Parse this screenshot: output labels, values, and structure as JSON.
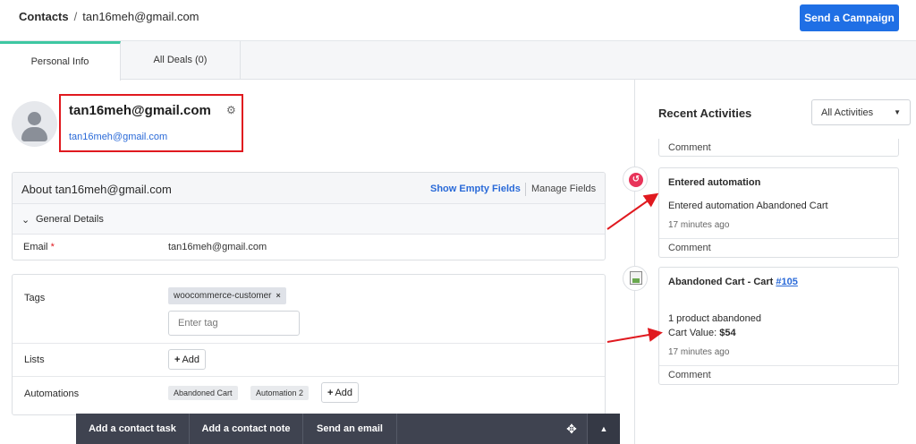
{
  "header": {
    "breadcrumb_root": "Contacts",
    "breadcrumb_sep": "/",
    "breadcrumb_current": "tan16meh@gmail.com",
    "send_campaign": "Send a Campaign"
  },
  "tabs": [
    {
      "label": "Personal Info",
      "active": true
    },
    {
      "label": "All Deals (0)",
      "active": false
    }
  ],
  "contact": {
    "name": "tan16meh@gmail.com",
    "email": "tan16meh@gmail.com"
  },
  "about": {
    "title": "About tan16meh@gmail.com",
    "show_empty": "Show Empty Fields",
    "manage": "Manage Fields",
    "section": "General Details",
    "email_label": "Email",
    "required_mark": "*",
    "email_value": "tan16meh@gmail.com"
  },
  "tags_panel": {
    "tags_label": "Tags",
    "tag": "woocommerce-customer",
    "tag_remove": "×",
    "tag_placeholder": "Enter tag",
    "lists_label": "Lists",
    "add_label": "Add",
    "automations_label": "Automations",
    "automations": [
      "Abandoned Cart",
      "Automation 2"
    ]
  },
  "actionbar": {
    "task": "Add a contact task",
    "note": "Add a contact note",
    "email": "Send an email"
  },
  "activities": {
    "title": "Recent Activities",
    "filter": "All Activities",
    "stub_comment": "Comment",
    "card1": {
      "title": "Entered automation",
      "text_prefix": "Entered automation ",
      "text_value": "Abandoned Cart",
      "time": "17 minutes ago",
      "comment": "Comment"
    },
    "card2": {
      "title": "Abandoned Cart - Cart ",
      "link": "#105",
      "count": "1",
      "count_text": " product abandoned",
      "value_label": "Cart Value: ",
      "value": "$54",
      "time": "17 minutes ago",
      "comment": "Comment"
    }
  },
  "colors": {
    "brand_blue": "#1f6fe5",
    "tab_accent": "#3ec7a2",
    "highlight_red": "#e0191f",
    "actionbar": "#3f4350"
  }
}
